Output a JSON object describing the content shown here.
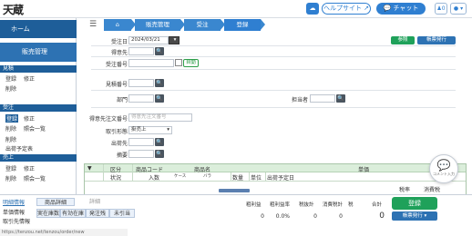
{
  "app": {
    "logo_text": "天蔵",
    "help_label": "ヘルプサイト",
    "chat_label": "チャット",
    "user_count": "0"
  },
  "breadcrumb": [
    "販売管理",
    "受注",
    "登録"
  ],
  "sidebar": {
    "home": "ホーム",
    "sales_mgmt": "販売管理",
    "sections": [
      {
        "title": "見積",
        "links": [
          [
            "登録",
            "修正"
          ],
          [
            "削除"
          ]
        ]
      },
      {
        "title": "受注",
        "links": [
          [
            "登録",
            "修正"
          ],
          [
            "削除",
            "照会一覧"
          ],
          [
            "削除"
          ],
          [
            "出荷予定表"
          ]
        ]
      },
      {
        "title": "売上",
        "links": [
          [
            "登録",
            "修正"
          ],
          [
            "削除",
            "照会一覧"
          ]
        ]
      }
    ]
  },
  "form": {
    "order_date_label": "受注日",
    "order_date_value": "2024/03/21",
    "customer_label": "得意先",
    "order_no_label": "受注番号",
    "order_no_toggle": "自動",
    "estimate_no_label": "見積番号",
    "dept_label": "部門",
    "person_label": "担当者",
    "customer_order_label": "得意先注文番号",
    "customer_order_placeholder": "得意先注文番号",
    "trade_type_label": "取引形態",
    "trade_type_value": "掛売上",
    "ship_to_label": "出荷先",
    "memo_label": "摘要",
    "btn_green": "参照",
    "btn_blue": "帳票発行"
  },
  "grid": {
    "headers_row1": [
      "区分",
      "商品コード",
      "商品名",
      "単価"
    ],
    "headers_row2": [
      "状況",
      "入数",
      "ケース",
      "バラ",
      "数量",
      "単位",
      "出荷予定日",
      "",
      "税率",
      "消費税"
    ]
  },
  "bottom": {
    "tabs": [
      "明細情報",
      "商品詳細",
      "詳細"
    ],
    "left_items": [
      "単価情報",
      "取引先情報"
    ],
    "sub_tabs": [
      "実在庫数",
      "有効在庫",
      "発注残",
      "未引当"
    ],
    "totals_headers": [
      "粗利益",
      "粗利益率",
      "税抜計",
      "消費税計",
      "税",
      "合計"
    ],
    "totals_values": [
      "0",
      "0.0%",
      "0",
      "0",
      "",
      "0"
    ],
    "register_button": "登録",
    "voucher_button": "帳票発行",
    "comment_label": "コメント入力"
  },
  "status_url": "https://tenzou.net/tenzou/order/new"
}
